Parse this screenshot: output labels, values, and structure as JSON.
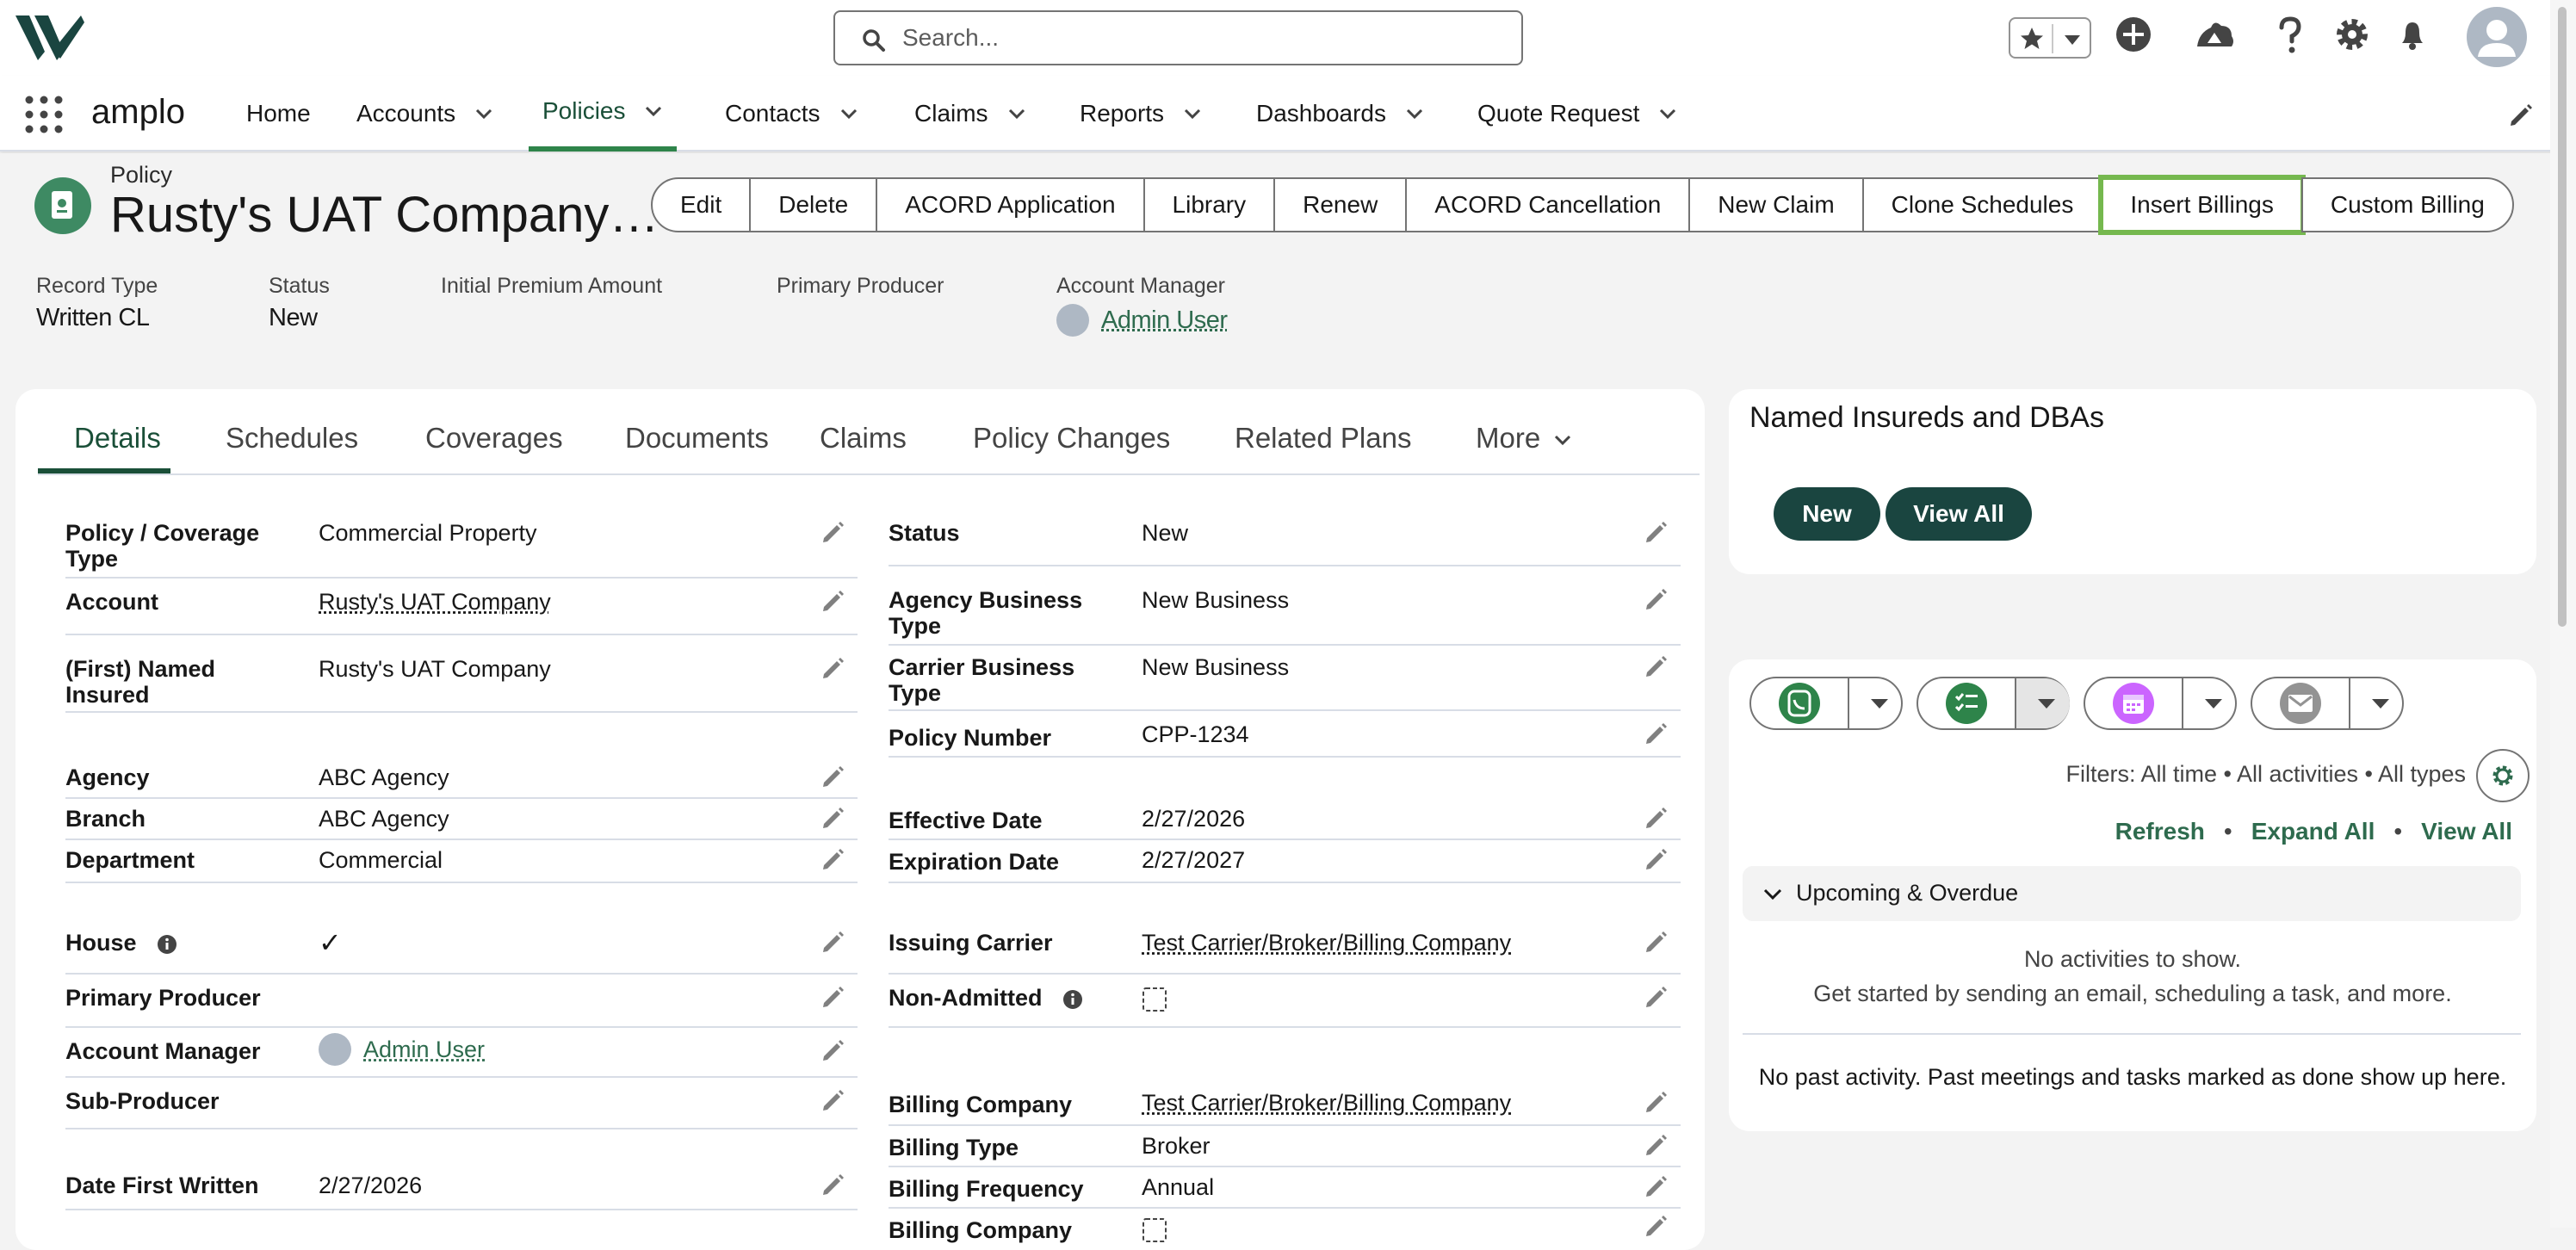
{
  "header": {
    "search_placeholder": "Search...",
    "logo_icon": "amplo-logo",
    "icons": [
      "star-icon",
      "add-icon",
      "trailhead-icon",
      "help-icon",
      "gear-icon",
      "bell-icon",
      "user-avatar"
    ]
  },
  "nav": {
    "app_name": "amplo",
    "items": [
      {
        "label": "Home",
        "dropdown": false
      },
      {
        "label": "Accounts",
        "dropdown": true
      },
      {
        "label": "Policies",
        "dropdown": true,
        "active": true
      },
      {
        "label": "Contacts",
        "dropdown": true
      },
      {
        "label": "Claims",
        "dropdown": true
      },
      {
        "label": "Reports",
        "dropdown": true
      },
      {
        "label": "Dashboards",
        "dropdown": true
      },
      {
        "label": "Quote Request",
        "dropdown": true
      }
    ]
  },
  "record": {
    "object_label": "Policy",
    "title": "Rusty's UAT Company…",
    "actions": [
      "Edit",
      "Delete",
      "ACORD Application",
      "Library",
      "Renew",
      "ACORD Cancellation",
      "New Claim",
      "Clone Schedules",
      "Insert Billings",
      "Custom Billing"
    ],
    "highlights": [
      {
        "label": "Record Type",
        "value": "Written CL"
      },
      {
        "label": "Status",
        "value": "New"
      },
      {
        "label": "Initial Premium Amount",
        "value": ""
      },
      {
        "label": "Primary Producer",
        "value": ""
      },
      {
        "label": "Account Manager",
        "value": "Admin User"
      }
    ]
  },
  "tabs": [
    "Details",
    "Schedules",
    "Coverages",
    "Documents",
    "Claims",
    "Policy Changes",
    "Related Plans",
    "More"
  ],
  "details": {
    "left": [
      {
        "label": "Policy / Coverage Type",
        "value": "Commercial Property"
      },
      {
        "label": "Account",
        "value": "Rusty's UAT Company"
      },
      {
        "label": "(First) Named Insured",
        "value": "Rusty's UAT Company"
      },
      {
        "label": "Agency",
        "value": "ABC Agency"
      },
      {
        "label": "Branch",
        "value": "ABC Agency"
      },
      {
        "label": "Department",
        "value": "Commercial"
      },
      {
        "label": "House",
        "value": "✓"
      },
      {
        "label": "Primary Producer",
        "value": ""
      },
      {
        "label": "Account Manager",
        "value": "Admin User"
      },
      {
        "label": "Sub-Producer",
        "value": ""
      },
      {
        "label": "Date First Written",
        "value": "2/27/2026"
      }
    ],
    "right": [
      {
        "label": "Status",
        "value": "New"
      },
      {
        "label": "Agency Business Type",
        "value": "New Business"
      },
      {
        "label": "Carrier Business Type",
        "value": "New Business"
      },
      {
        "label": "Policy Number",
        "value": "CPP-1234"
      },
      {
        "label": "Effective Date",
        "value": "2/27/2026"
      },
      {
        "label": "Expiration Date",
        "value": "2/27/2027"
      },
      {
        "label": "Issuing Carrier",
        "value": "Test Carrier/Broker/Billing Company"
      },
      {
        "label": "Non-Admitted",
        "value": ""
      },
      {
        "label": "Billing Company",
        "value": "Test Carrier/Broker/Billing Company"
      },
      {
        "label": "Billing Type",
        "value": "Broker"
      },
      {
        "label": "Billing Frequency",
        "value": "Annual"
      },
      {
        "label": "Billing Company",
        "value": ""
      }
    ]
  },
  "named_insureds": {
    "title": "Named Insureds and DBAs",
    "new_label": "New",
    "view_all_label": "View All"
  },
  "activity": {
    "filters": "Filters: All time • All activities • All types",
    "refresh": "Refresh",
    "expand_all": "Expand All",
    "view_all": "View All",
    "separator": "•",
    "upcoming": "Upcoming & Overdue",
    "no_activities": "No activities to show.",
    "get_started": "Get started by sending an email, scheduling a task, and more.",
    "no_past": "No past activity. Past meetings and tasks marked as done show up here."
  },
  "colors": {
    "brand_green": "#1a4540",
    "accent_green": "#2e844a",
    "highlight_outline": "#75b84e",
    "link_green": "#2e6b4e"
  }
}
